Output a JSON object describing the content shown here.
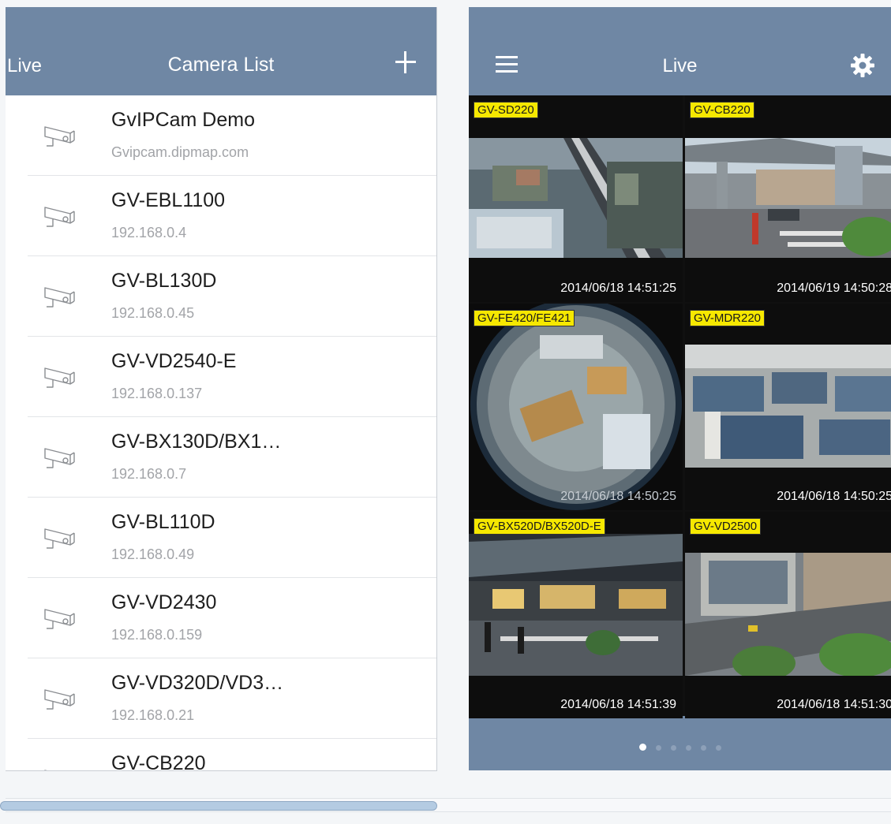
{
  "left_panel": {
    "nav": {
      "back_label": "Live",
      "title": "Camera List",
      "add_icon": "plus-icon"
    },
    "cameras": [
      {
        "name": "GvIPCam Demo",
        "address": "Gvipcam.dipmap.com",
        "icon": "camera-icon"
      },
      {
        "name": "GV-EBL1100",
        "address": "192.168.0.4",
        "icon": "camera-icon"
      },
      {
        "name": "GV-BL130D",
        "address": "192.168.0.45",
        "icon": "camera-icon"
      },
      {
        "name": "GV-VD2540-E",
        "address": "192.168.0.137",
        "icon": "camera-icon"
      },
      {
        "name": "GV-BX130D/BX1…",
        "address": "192.168.0.7",
        "icon": "camera-icon"
      },
      {
        "name": "GV-BL110D",
        "address": "192.168.0.49",
        "icon": "camera-icon"
      },
      {
        "name": "GV-VD2430",
        "address": "192.168.0.159",
        "icon": "camera-icon"
      },
      {
        "name": "GV-VD320D/VD3…",
        "address": "192.168.0.21",
        "icon": "camera-icon"
      },
      {
        "name": "GV-CB220",
        "address": "",
        "icon": "camera-icon"
      }
    ]
  },
  "right_panel": {
    "nav": {
      "menu_icon": "hamburger-menu-icon",
      "title": "Live",
      "settings_icon": "gear-icon"
    },
    "tiles": [
      {
        "label": "GV-SD220",
        "timestamp": "2014/06/18 14:51:25",
        "scene": "aerial city street"
      },
      {
        "label": "GV-CB220",
        "timestamp": "2014/06/19 14:50:28",
        "scene": "street crossing"
      },
      {
        "label": "GV-FE420/FE421",
        "timestamp": "2014/06/18 14:50:25",
        "scene": "fisheye office"
      },
      {
        "label": "GV-MDR220",
        "timestamp": "2014/06/18 14:50:25",
        "scene": "office cubicles"
      },
      {
        "label": "GV-BX520D/BX520D-E",
        "timestamp": "2014/06/18 14:51:39",
        "scene": "night street"
      },
      {
        "label": "GV-VD2500",
        "timestamp": "2014/06/18 14:51:30",
        "scene": "building and road"
      }
    ],
    "pager": {
      "total_pages": 6,
      "current_page": 1
    }
  },
  "colors": {
    "nav_bar": "#6f87a4",
    "label_bg": "#f6e800",
    "secondary_text": "#a2a4a8"
  }
}
